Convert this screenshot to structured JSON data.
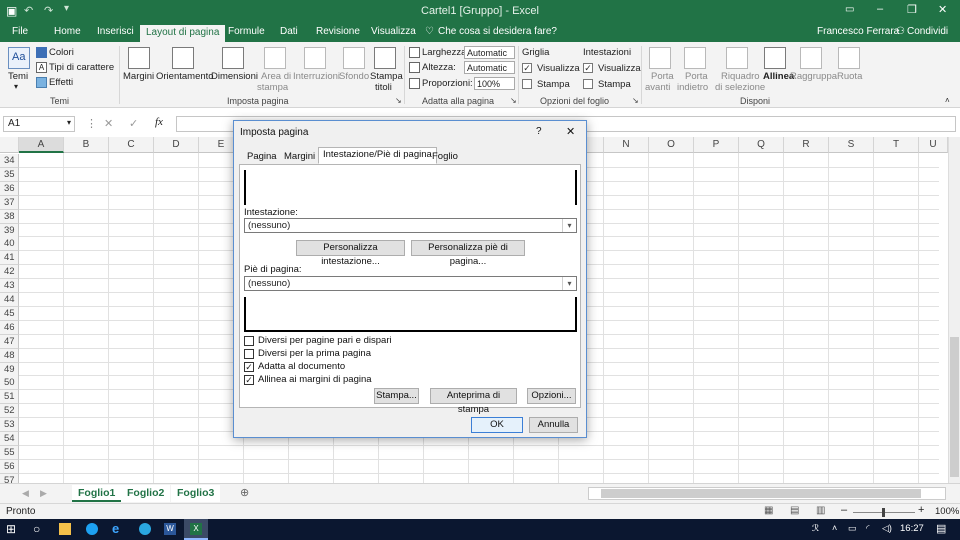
{
  "window": {
    "title": "Cartel1  [Gruppo]  -  Excel",
    "user": "Francesco Ferrara",
    "share": "Condividi"
  },
  "tabs": [
    "File",
    "Home",
    "Inserisci",
    "Layout di pagina",
    "Formule",
    "Dati",
    "Revisione",
    "Visualizza"
  ],
  "search": "Che cosa si desidera fare?",
  "ribbon": {
    "temi": {
      "group": "Temi",
      "btn": "Temi",
      "colori": "Colori",
      "tipi": "Tipi di carattere",
      "effetti": "Effetti"
    },
    "imposta": {
      "group": "Imposta pagina",
      "margini": "Margini",
      "orientamento": "Orientamento",
      "dimensioni": "Dimensioni",
      "area_1": "Area di",
      "area_2": "stampa",
      "interruzioni": "Interruzioni",
      "sfondo": "Sfondo",
      "stampa_1": "Stampa",
      "stampa_2": "titoli"
    },
    "adatta": {
      "group": "Adatta alla pagina",
      "larghezza": "Larghezza:",
      "larghezza_val": "Automatic",
      "altezza": "Altezza:",
      "altezza_val": "Automatic",
      "proporzioni": "Proporzioni:",
      "proporzioni_val": "100%"
    },
    "opzioni": {
      "group": "Opzioni del foglio",
      "griglia": "Griglia",
      "intestazioni": "Intestazioni",
      "visualizza": "Visualizza",
      "stampa": "Stampa"
    },
    "disponi": {
      "group": "Disponi",
      "porta_avanti_1": "Porta",
      "porta_avanti_2": "avanti",
      "porta_indietro_1": "Porta",
      "porta_indietro_2": "indietro",
      "riquadro_1": "Riquadro",
      "riquadro_2": "di selezione",
      "allinea": "Allinea",
      "raggruppa": "Raggruppa",
      "ruota": "Ruota"
    }
  },
  "formula": {
    "namebox": "A1",
    "fx": "fx"
  },
  "columns": [
    "A",
    "B",
    "C",
    "D",
    "E",
    "F",
    "G",
    "H",
    "I",
    "J",
    "K",
    "L",
    "M",
    "N",
    "O",
    "P",
    "Q",
    "R",
    "S",
    "T",
    "U"
  ],
  "rows": [
    "34",
    "35",
    "36",
    "37",
    "38",
    "39",
    "40",
    "41",
    "42",
    "43",
    "44",
    "45",
    "46",
    "47",
    "48",
    "49",
    "50",
    "51",
    "52",
    "53",
    "54",
    "55",
    "56",
    "57"
  ],
  "sheets": [
    "Foglio1",
    "Foglio2",
    "Foglio3"
  ],
  "status": {
    "left": "Pronto",
    "zoom": "100%"
  },
  "taskbar": {
    "time": "16:27"
  },
  "dialog": {
    "title": "Imposta pagina",
    "help": "?",
    "close": "✕",
    "tabs": [
      "Pagina",
      "Margini",
      "Intestazione/Piè di pagina",
      "Foglio"
    ],
    "intestazione_label": "Intestazione:",
    "intestazione_value": "(nessuno)",
    "personalizza_intestazione": "Personalizza intestazione...",
    "personalizza_pie": "Personalizza piè di pagina...",
    "pie_label": "Piè di pagina:",
    "pie_value": "(nessuno)",
    "checkboxes": [
      {
        "label": "Diversi per pagine pari e dispari",
        "checked": false
      },
      {
        "label": "Diversi per la prima pagina",
        "checked": false
      },
      {
        "label": "Adatta al documento",
        "checked": true
      },
      {
        "label": "Allinea ai margini di pagina",
        "checked": true
      }
    ],
    "btn_stampa": "Stampa...",
    "btn_anteprima": "Anteprima di stampa",
    "btn_opzioni": "Opzioni...",
    "btn_ok": "OK",
    "btn_annulla": "Annulla"
  },
  "colors": {
    "accent": "#217346",
    "dialog_border": "#5a8ed0"
  }
}
